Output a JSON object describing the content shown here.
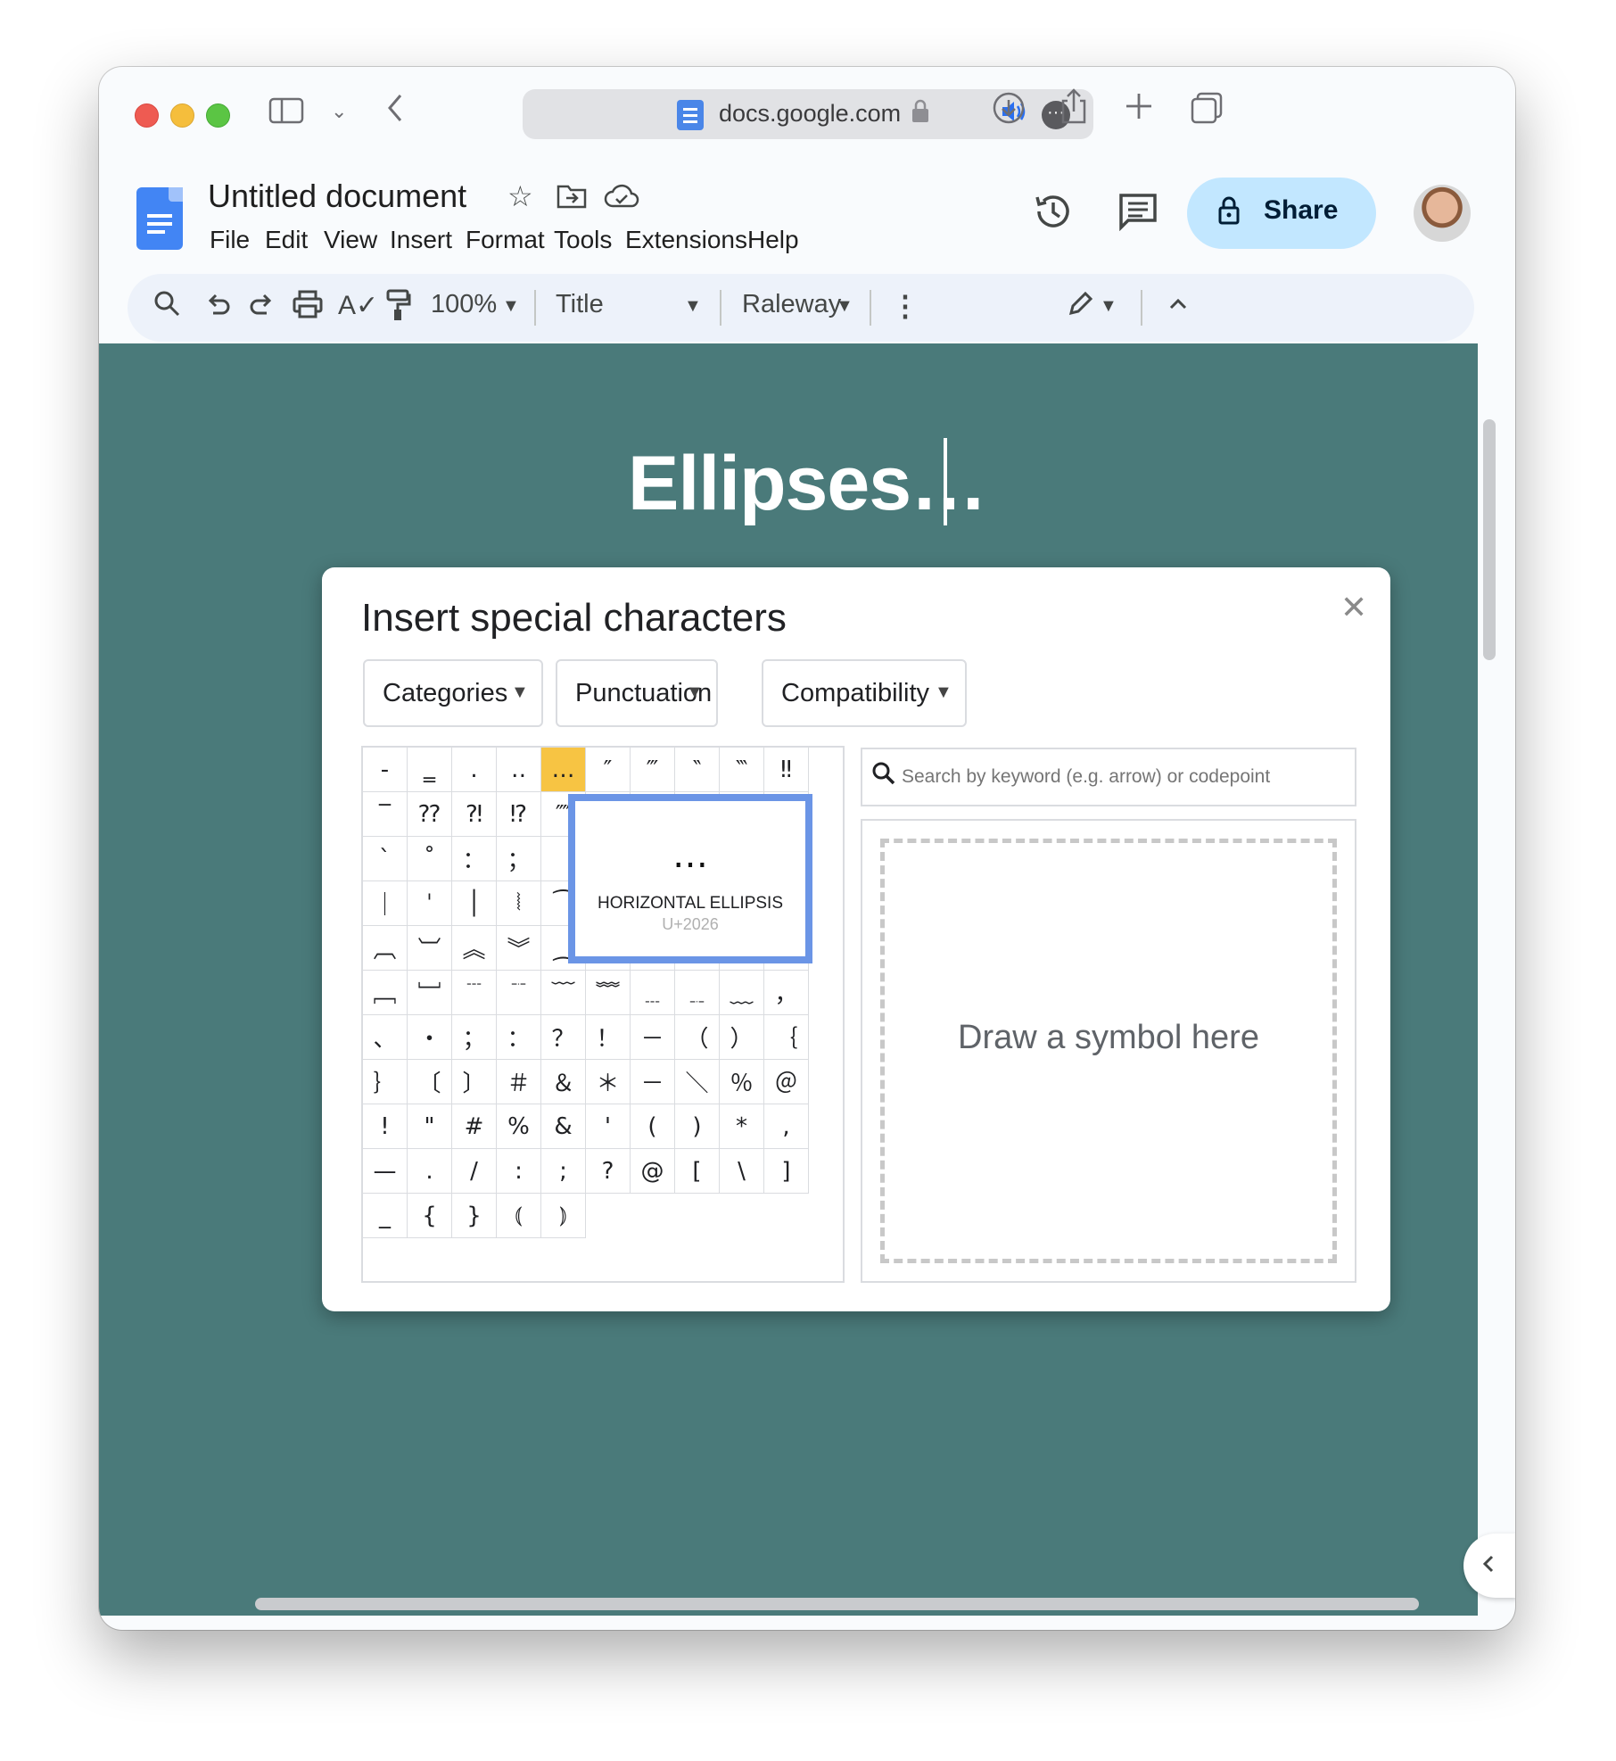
{
  "browser": {
    "url": "docs.google.com"
  },
  "docs": {
    "title": "Untitled document",
    "menu": [
      "File",
      "Edit",
      "View",
      "Insert",
      "Format",
      "Tools",
      "Extensions",
      "Help"
    ],
    "share_label": "Share"
  },
  "toolbar": {
    "zoom": "100%",
    "style": "Title",
    "font": "Raleway"
  },
  "document": {
    "heading": "Ellipses…",
    "background_color": "#4a7a7a"
  },
  "dialog": {
    "title": "Insert special characters",
    "dropdowns": [
      "Categories",
      "Punctuation",
      "Compatibility"
    ],
    "characters": [
      "‐",
      "‗",
      "․",
      "‥",
      "…",
      "″",
      "‴",
      "‶",
      "‷",
      "‼",
      "‾",
      "⁇",
      "⁈",
      "⁉",
      "⁗",
      "",
      "",
      "",
      "",
      "",
      "ˋ",
      "˚",
      "：",
      "；",
      "",
      "",
      "",
      "",
      "",
      "",
      "｜",
      "ˈ",
      "│",
      "⦚",
      "⁀",
      "",
      "",
      "",
      "",
      "",
      "︹",
      "︺",
      "︽",
      "︾",
      "⁔",
      "",
      "",
      "",
      "",
      "",
      "﹇",
      "﹈",
      "﹉",
      "﹊",
      "﹋",
      "﹌",
      "﹍",
      "﹎",
      "﹏",
      "，",
      "、",
      "・",
      "；",
      "：",
      "？",
      "！",
      "－",
      "（",
      "）",
      "｛",
      "｝",
      "〔",
      "〕",
      "＃",
      "＆",
      "＊",
      "－",
      "＼",
      "％",
      "＠",
      "!",
      "\"",
      "#",
      "%",
      "&",
      "'",
      "(",
      ")",
      "*",
      ",",
      "—",
      ".",
      "/",
      ":",
      ";",
      "?",
      "@",
      "[",
      "\\",
      "]",
      "_",
      "{",
      "}",
      "⦅",
      "⦆"
    ],
    "selected_index": 4,
    "preview": {
      "glyph": "…",
      "name": "HORIZONTAL ELLIPSIS",
      "codepoint": "U+2026"
    },
    "search_placeholder": "Search by keyword (e.g. arrow) or codepoint",
    "draw_label": "Draw a symbol here",
    "preview_border_color": "#6b95e6",
    "selected_color": "#f7c443"
  }
}
